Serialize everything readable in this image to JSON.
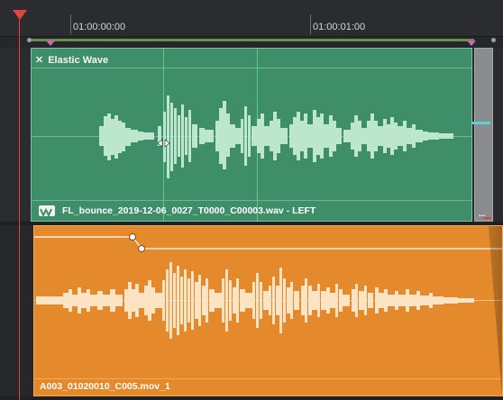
{
  "ruler": {
    "timecodes": [
      "01:00:00:00",
      "01:00:01:00"
    ]
  },
  "track_v1": {
    "clip": {
      "effect_label": "Elastic Wave",
      "file_name": "FL_bounce_2019-12-06_0027_T0000_C00003.wav - LEFT"
    },
    "side_clip": {
      "menu_label": "..."
    }
  },
  "track_a1": {
    "clip": {
      "file_name": "A003_01020010_C005.mov_1"
    }
  },
  "colors": {
    "green_clip": "#3e8e6a",
    "green_waveform": "#bde6cf",
    "orange_clip": "#e48a2d",
    "orange_waveform": "#fbe3c4",
    "playhead": "#e0453c",
    "marker": "#d565b2",
    "in_out_range": "#6a8f4c"
  },
  "icons": {
    "effect_close": "close-icon",
    "clip_type": "waveform-icon"
  }
}
